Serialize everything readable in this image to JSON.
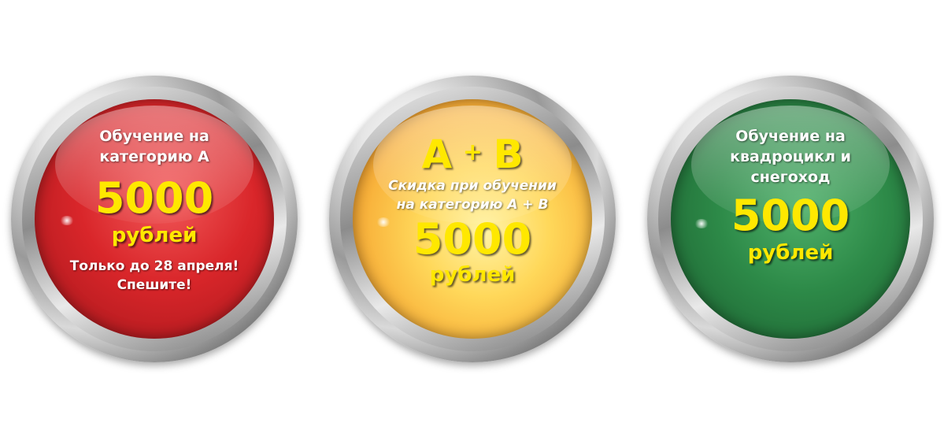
{
  "badges": [
    {
      "color": "red",
      "line1": "Обучение на",
      "line2": "категорию А",
      "price": "5000",
      "currency": "рублей",
      "note1": "Только до 28 апреля!",
      "note2": "Спешите!"
    },
    {
      "color": "amber",
      "heading_a": "А",
      "heading_plus": "+",
      "heading_b": "В",
      "line1": "Скидка при обучении",
      "line2": "на категорию А + В",
      "price": "5000",
      "currency": "рублей"
    },
    {
      "color": "green",
      "line1": "Обучение на",
      "line2": "квадроцикл и",
      "line3": "снегоход",
      "price": "5000",
      "currency": "рублей"
    }
  ],
  "colors": {
    "red": "#d9262a",
    "amber": "#ffd85a",
    "green": "#2d8a48",
    "price_text": "#ffe800",
    "ring": "#b0b0b0"
  }
}
